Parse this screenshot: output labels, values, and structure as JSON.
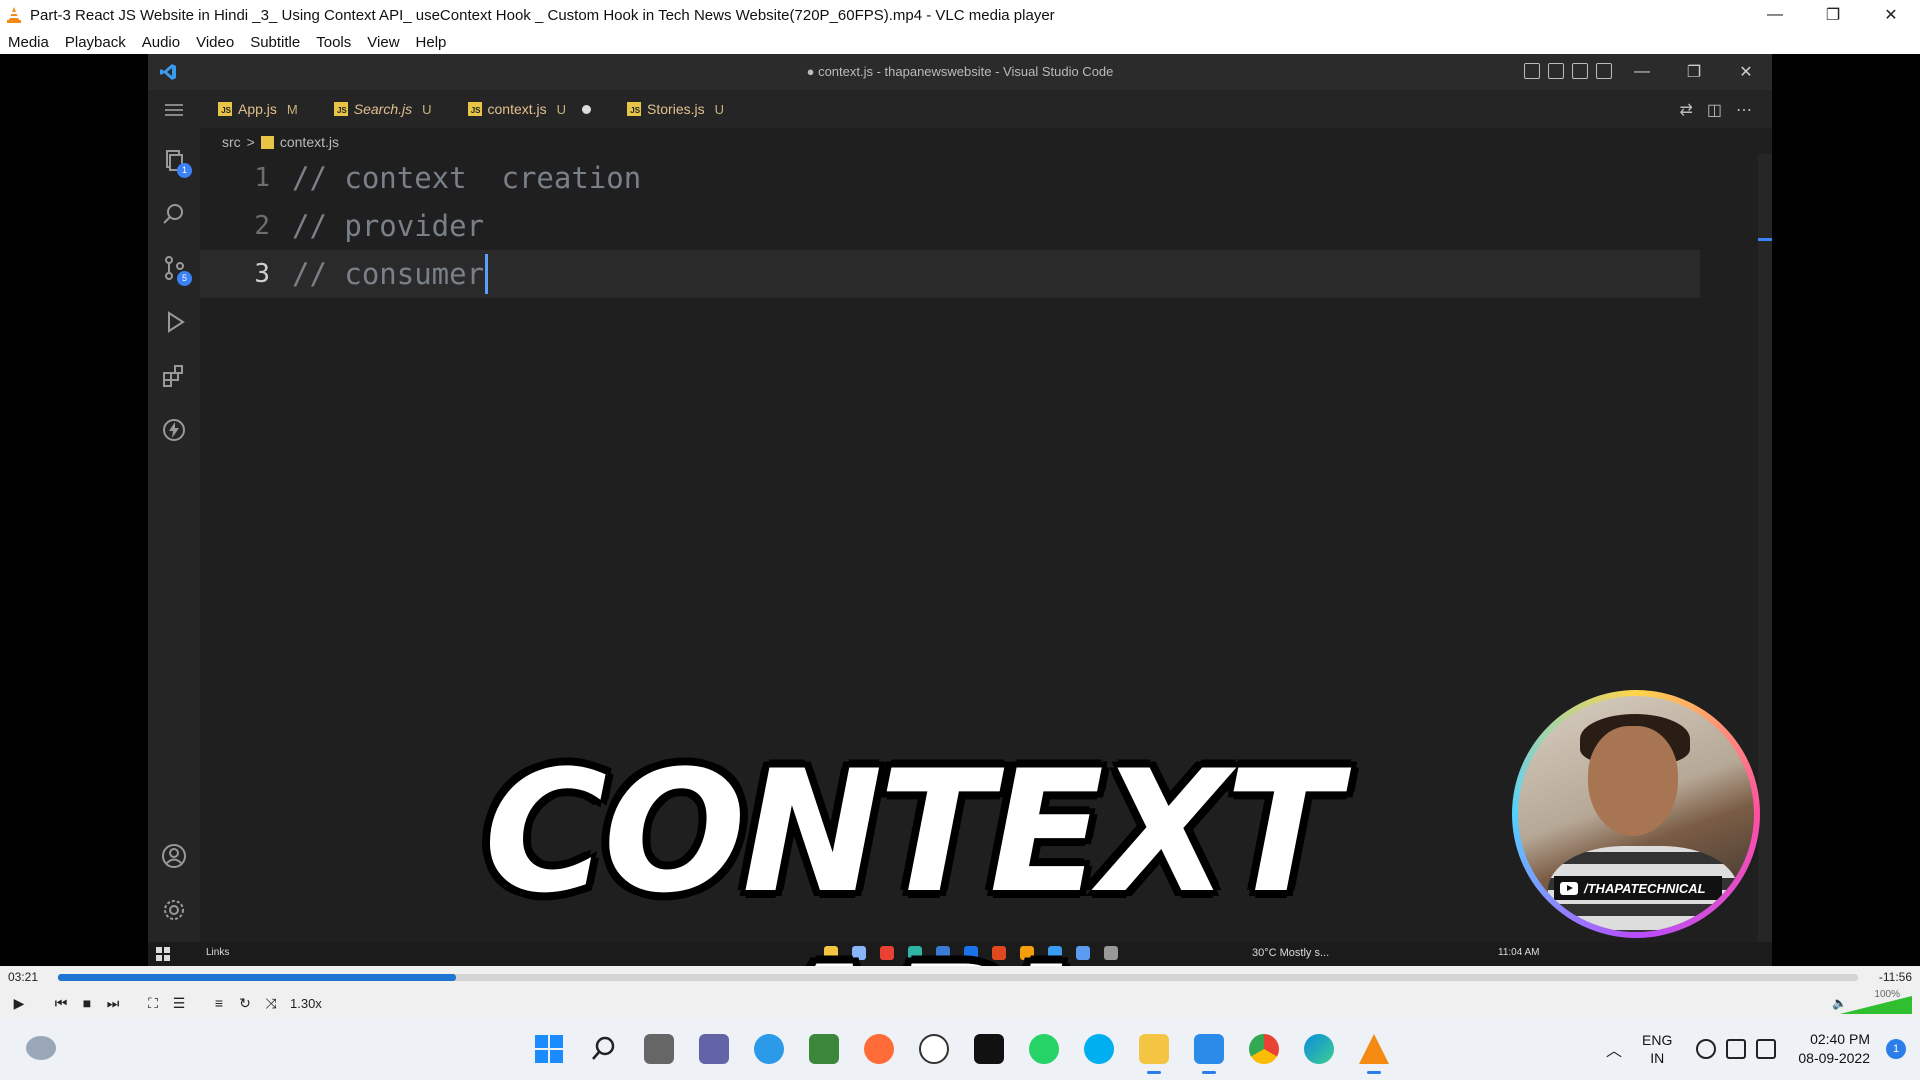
{
  "window": {
    "title": "Part-3  React JS Website in Hindi _3_ Using Context API_ useContext Hook _ Custom Hook in Tech News Website(720P_60FPS).mp4 - VLC media player",
    "minimize": "—",
    "restore": "❐",
    "close": "✕"
  },
  "menu": [
    "Media",
    "Playback",
    "Audio",
    "Video",
    "Subtitle",
    "Tools",
    "View",
    "Help"
  ],
  "vscode": {
    "title": "● context.js - thapanewswebsite - Visual Studio Code",
    "tabs": [
      {
        "name": "App.js",
        "flag": "M"
      },
      {
        "name": "Search.js",
        "flag": "U"
      },
      {
        "name": "context.js",
        "flag": "U"
      },
      {
        "name": "Stories.js",
        "flag": "U"
      }
    ],
    "breadcrumb": {
      "folder": "src",
      "sep": ">",
      "file": "context.js"
    },
    "badges": {
      "explorer": "1",
      "source_control": "5"
    },
    "lines": [
      {
        "num": "1",
        "text": "// context  creation"
      },
      {
        "num": "2",
        "text": "// provider"
      },
      {
        "num": "3",
        "text": "// consumer"
      }
    ],
    "inner_taskbar": {
      "search": "Links",
      "weather": "30°C  Mostly s...",
      "time": "11:04 AM"
    }
  },
  "overlay": {
    "caption": "CONTEXT API",
    "channel": "/THAPATECHNICAL"
  },
  "player": {
    "elapsed": "03:21",
    "remaining": "-11:56",
    "progress_fraction": 0.221,
    "speed": "1.30x",
    "volume": "100%",
    "volume_fraction": 1.0
  },
  "taskbar": {
    "lang_1": "ENG",
    "lang_2": "IN",
    "time": "02:40 PM",
    "date": "08-09-2022",
    "notifications": "1"
  },
  "colors": {
    "seek": "#1f76d2",
    "accent": "#2b7de9",
    "vscode_bg": "#1f1f1f"
  }
}
